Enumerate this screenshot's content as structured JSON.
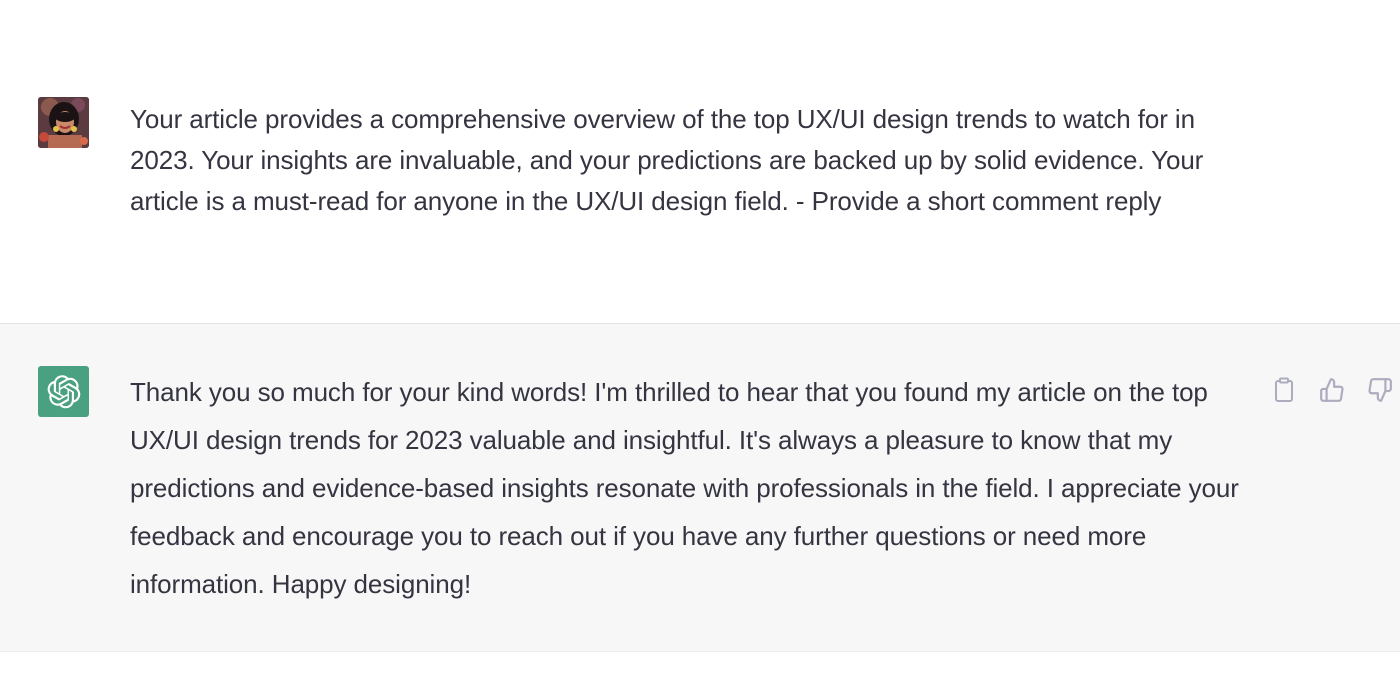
{
  "conversation": {
    "user_message": {
      "text": "Your article provides a comprehensive overview of the top UX/UI design trends to watch for in 2023. Your insights are invaluable, and your predictions are backed up by solid evidence. Your article is a must-read for anyone in the UX/UI design field. - Provide a short comment reply",
      "avatar_icon": "user-photo-avatar"
    },
    "assistant_message": {
      "text": "Thank you so much for your kind words! I'm thrilled to hear that you found my article on the top UX/UI design trends for 2023 valuable and insightful. It's always a pleasure to know that my predictions and evidence-based insights resonate with professionals in the field. I appreciate your feedback and encourage you to reach out if you have any further questions or need more information. Happy designing!",
      "avatar_icon": "openai-logo-icon",
      "actions": [
        {
          "icon": "clipboard-icon"
        },
        {
          "icon": "thumbs-up-icon"
        },
        {
          "icon": "thumbs-down-icon"
        }
      ]
    }
  },
  "colors": {
    "text": "#343541",
    "assistant_bg": "#f7f7f8",
    "user_bg": "#ffffff",
    "bot_avatar_bg": "#4aa181",
    "icon_gray": "#acacbe"
  }
}
